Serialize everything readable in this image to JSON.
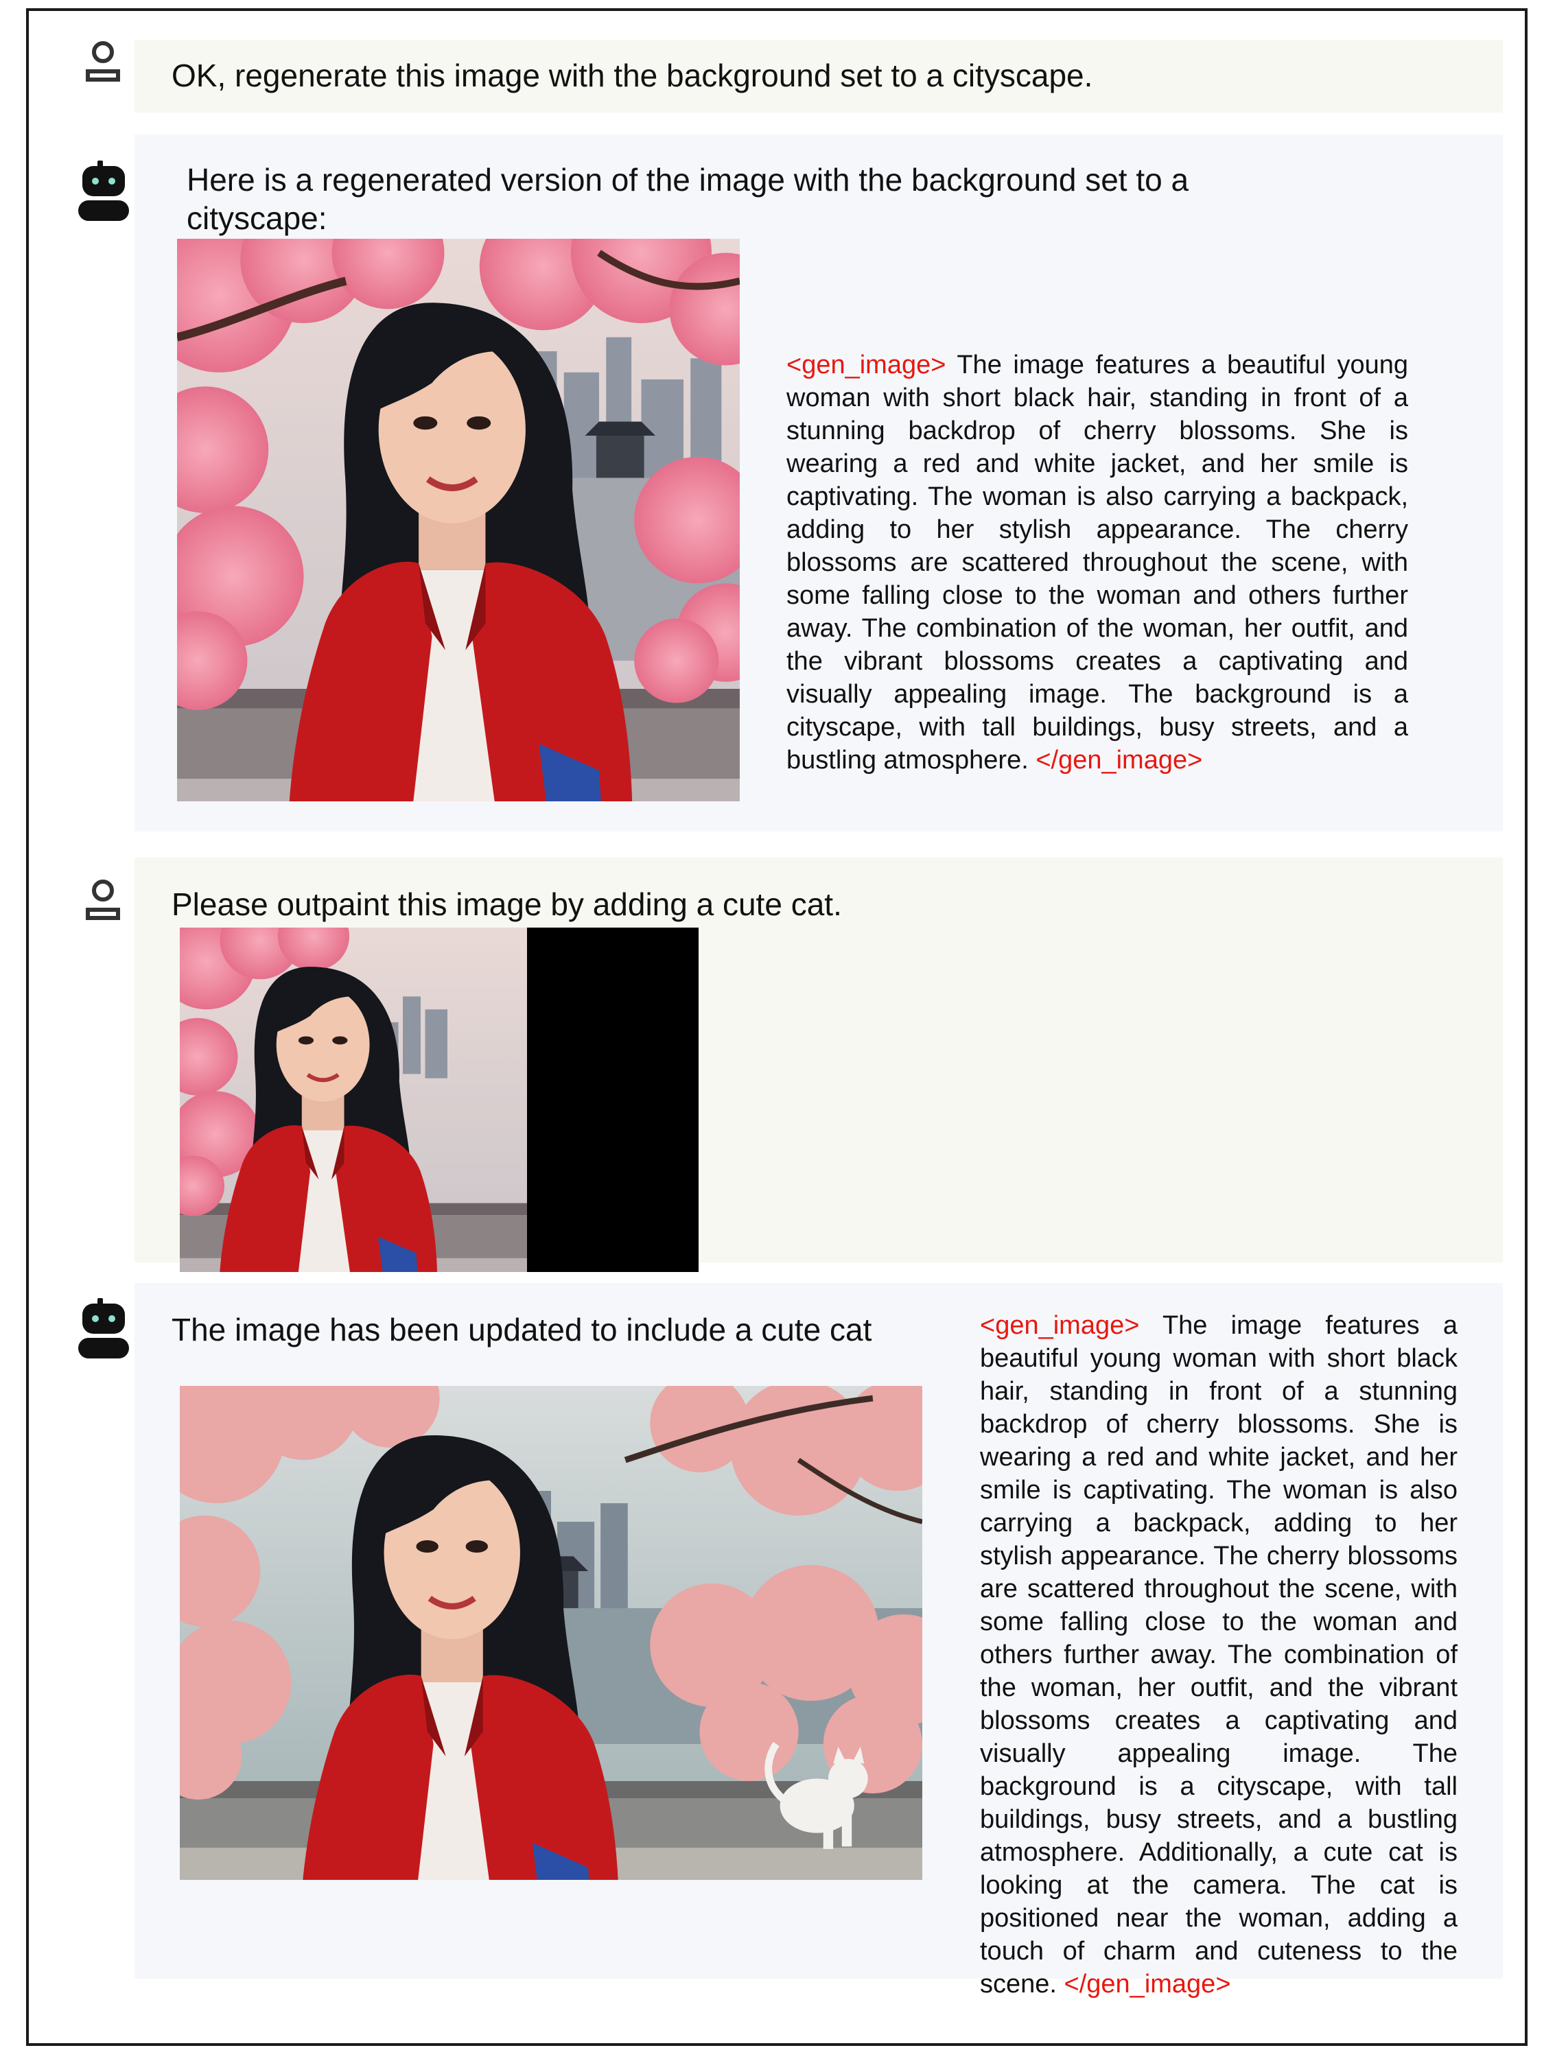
{
  "messages": [
    {
      "role": "user",
      "text": "OK, regenerate this image with the background set to a cityscape."
    },
    {
      "role": "assistant",
      "text": "Here is a regenerated version of the image with the background set to a cityscape:",
      "image": "woman-cherry-blossom-cityscape",
      "caption_open": "<gen_image>",
      "caption": " The image features a beautiful young woman with short black hair, standing in front of a stunning backdrop of cherry blossoms. She is wearing a red and white jacket, and her smile is captivating. The woman is also carrying a backpack, adding to her stylish appearance. The cherry blossoms are scattered throughout the scene, with some falling close to the woman and others further away. The combination of the woman, her outfit, and the vibrant blossoms creates a captivating and visually appealing image. The background is a cityscape, with tall buildings, busy streets, and a bustling atmosphere.",
      "caption_close": "</gen_image>"
    },
    {
      "role": "user",
      "text": "Please outpaint this image by adding a cute cat.",
      "image": "woman-with-black-outpaint-region"
    },
    {
      "role": "assistant",
      "text": "The image has been updated to include a cute cat",
      "image": "woman-with-cute-cat",
      "caption_open": "<gen_image>",
      "caption": " The image features a beautiful young woman with short black hair, standing in front of a stunning backdrop of cherry blossoms. She is wearing a red and white jacket, and her smile is captivating. The woman is also carrying a backpack, adding to her stylish appearance. The cherry blossoms are scattered throughout the scene, with some falling close to the woman and others further away. The combination of the woman, her outfit, and the vibrant blossoms creates a captivating and visually appealing image. The background is a cityscape, with tall buildings, busy streets, and a bustling atmosphere. Additionally, a cute cat is looking at the camera. The cat is positioned near the woman, adding a touch of charm and cuteness to the scene.",
      "caption_close": "</gen_image>"
    }
  ],
  "icons": {
    "user": "user-icon",
    "assistant": "robot-icon"
  },
  "colors": {
    "tag": "#e8170f",
    "user_bubble": "#f6f8f1",
    "bot_bubble": "#f5f7fb",
    "outpaint_mask": "#000000"
  }
}
